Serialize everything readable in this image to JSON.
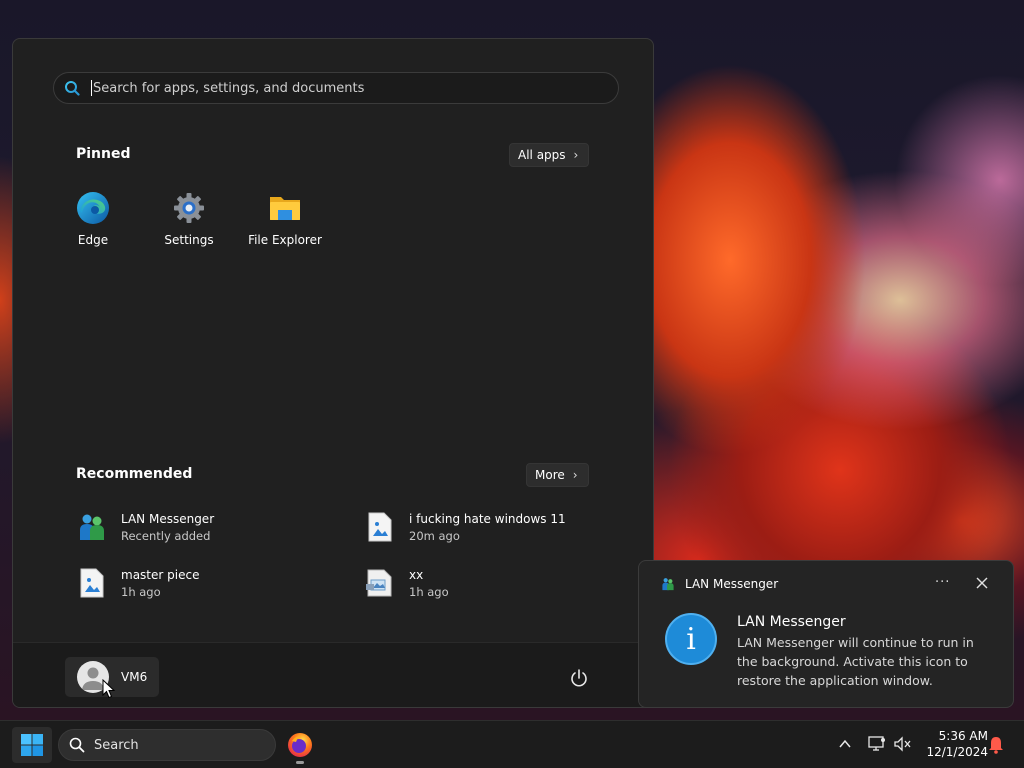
{
  "colors": {
    "accent": "#1e8bd8",
    "start_bg": "#202020",
    "taskbar_bg": "#1c1c1c",
    "bell": "#ff5a4a"
  },
  "start_menu": {
    "search_placeholder": "Search for apps, settings, and documents",
    "pinned": {
      "title": "Pinned",
      "all_apps_label": "All apps",
      "apps": [
        {
          "label": "Edge",
          "icon": "edge-icon"
        },
        {
          "label": "Settings",
          "icon": "gear-icon"
        },
        {
          "label": "File Explorer",
          "icon": "folder-icon"
        }
      ]
    },
    "recommended": {
      "title": "Recommended",
      "more_label": "More",
      "items": [
        {
          "name": "LAN Messenger",
          "subtitle": "Recently added",
          "icon": "lan-messenger-icon"
        },
        {
          "name": "i fucking hate windows 11",
          "subtitle": "20m ago",
          "icon": "image-file-icon"
        },
        {
          "name": "master piece",
          "subtitle": "1h ago",
          "icon": "image-file-icon"
        },
        {
          "name": "xx",
          "subtitle": "1h ago",
          "icon": "paint-file-icon"
        }
      ]
    },
    "user": {
      "name": "VM6"
    }
  },
  "notification": {
    "app_name": "LAN Messenger",
    "title": "LAN Messenger",
    "body": "LAN Messenger will continue to run in the background. Activate this icon to restore the application window.",
    "icon": "info-icon"
  },
  "taskbar": {
    "search_label": "Search",
    "clock": {
      "time": "5:36 AM",
      "date": "12/1/2024"
    }
  }
}
